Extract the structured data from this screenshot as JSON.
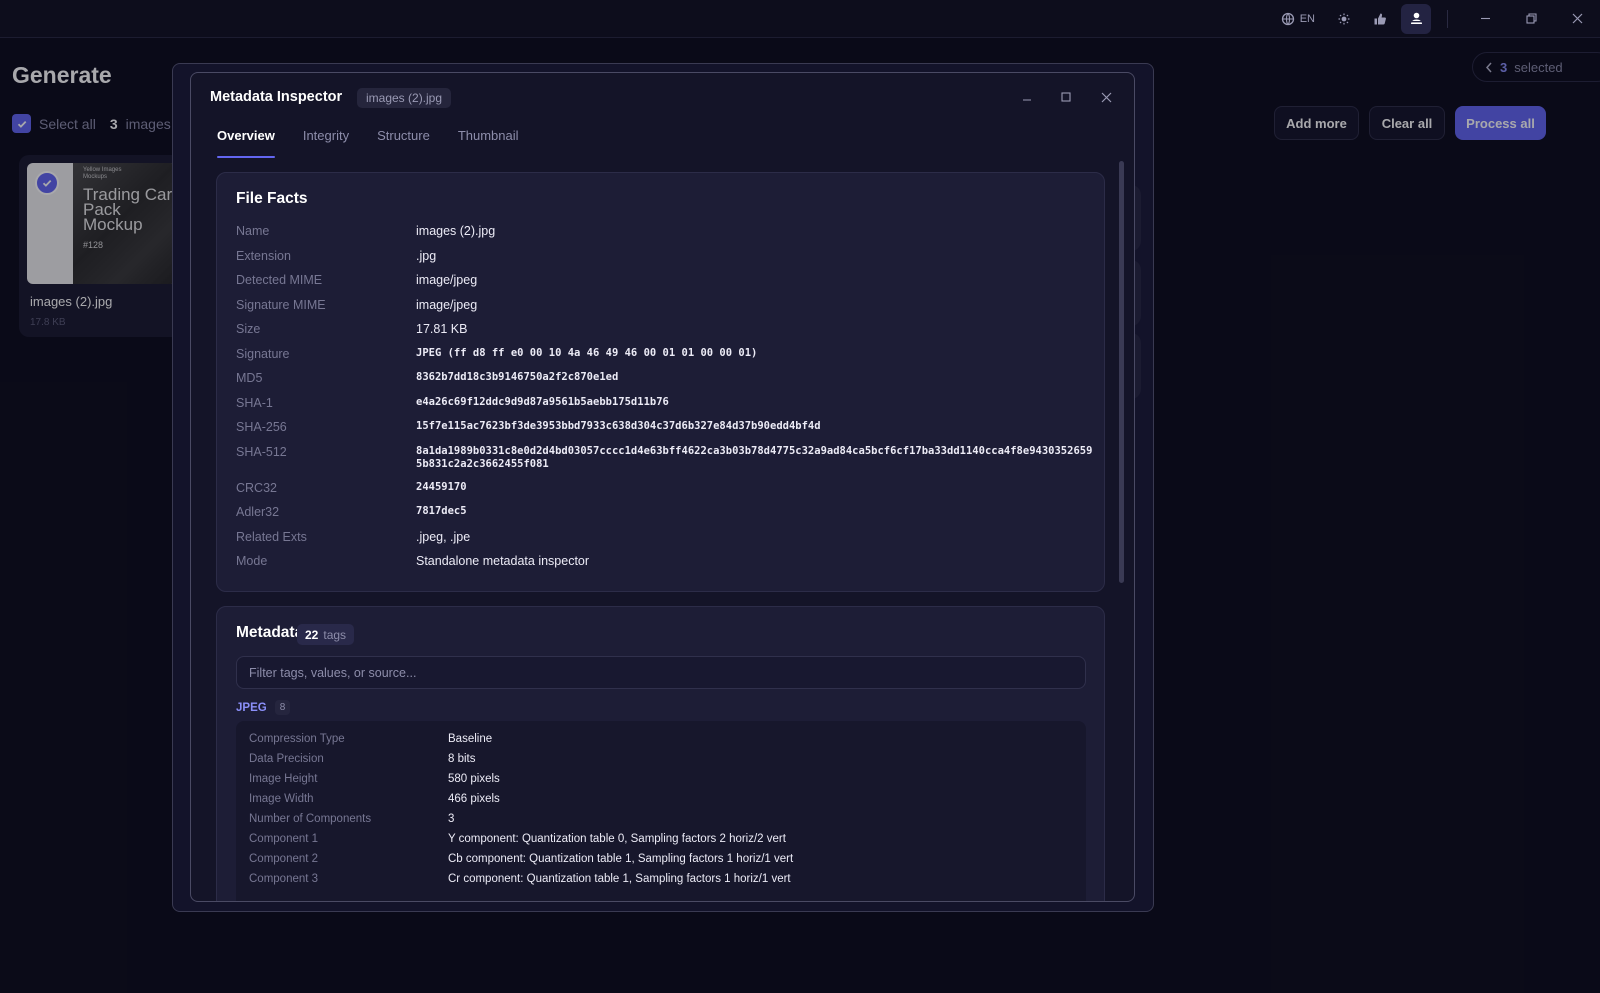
{
  "topbar": {
    "lang": "EN",
    "icons": [
      "globe-icon",
      "sun-icon",
      "thumbs-up-icon",
      "user-settings-icon"
    ],
    "window": [
      "minimize-icon",
      "restore-icon",
      "close-icon"
    ]
  },
  "page": {
    "title": "Generate",
    "select_all_label": "Select all",
    "image_count": "3",
    "image_unit": "images"
  },
  "card": {
    "name": "images (2).jpg",
    "size": "17.8 KB",
    "thumb_small": "Yellow Images\nMockups",
    "thumb_big": "Trading Card Pack Mockup",
    "thumb_num": "#128"
  },
  "toolbar": {
    "selected_count": "3",
    "selected_label": "selected",
    "add_more": "Add more",
    "clear_all": "Clear all",
    "process_all": "Process all"
  },
  "modal": {
    "title": "Metadata Inspector",
    "file_chip": "images (2).jpg",
    "tabs": [
      "Overview",
      "Integrity",
      "Structure",
      "Thumbnail"
    ],
    "active_tab": "Overview"
  },
  "file_facts": {
    "title": "File Facts",
    "rows": [
      {
        "label": "Name",
        "value": "images (2).jpg"
      },
      {
        "label": "Extension",
        "value": ".jpg"
      },
      {
        "label": "Detected MIME",
        "value": "image/jpeg"
      },
      {
        "label": "Signature MIME",
        "value": "image/jpeg"
      },
      {
        "label": "Size",
        "value": "17.81 KB"
      },
      {
        "label": "Signature",
        "value": "JPEG (ff d8 ff e0 00 10 4a 46 49 46 00 01 01 00 00 01)"
      },
      {
        "label": "MD5",
        "value": "8362b7dd18c3b9146750a2f2c870e1ed"
      },
      {
        "label": "SHA-1",
        "value": "e4a26c69f12ddc9d9d87a9561b5aebb175d11b76"
      },
      {
        "label": "SHA-256",
        "value": "15f7e115ac7623bf3de3953bbd7933c638d304c37d6b327e84d37b90edd4bf4d"
      },
      {
        "label": "SHA-512",
        "value": "8a1da1989b0331c8e0d2d4bd03057cccc1d4e63bff4622ca3b03b78d4775c32a9ad84ca5bcf6cf17ba33dd1140cca4f8e94303526595b831c2a2c3662455f081"
      },
      {
        "label": "CRC32",
        "value": "24459170"
      },
      {
        "label": "Adler32",
        "value": "7817dec5"
      },
      {
        "label": "Related Exts",
        "value": ".jpeg, .jpe"
      },
      {
        "label": "Mode",
        "value": "Standalone metadata inspector"
      }
    ]
  },
  "metadata": {
    "title": "Metadata",
    "tag_count": "22",
    "tag_word": "tags",
    "filter_placeholder": "Filter tags, values, or source...",
    "group": {
      "name": "JPEG",
      "count": "8",
      "rows": [
        {
          "label": "Compression Type",
          "value": "Baseline"
        },
        {
          "label": "Data Precision",
          "value": "8 bits"
        },
        {
          "label": "Image Height",
          "value": "580 pixels"
        },
        {
          "label": "Image Width",
          "value": "466 pixels"
        },
        {
          "label": "Number of Components",
          "value": "3"
        },
        {
          "label": "Component 1",
          "value": "Y component: Quantization table 0, Sampling factors 2 horiz/2 vert"
        },
        {
          "label": "Component 2",
          "value": "Cb component: Quantization table 1, Sampling factors 1 horiz/1 vert"
        },
        {
          "label": "Component 3",
          "value": "Cr component: Quantization table 1, Sampling factors 1 horiz/1 vert"
        }
      ]
    }
  },
  "colors": {
    "accent": "#6366f1",
    "background": "#0d0d1c",
    "panel": "#1d1d36"
  }
}
